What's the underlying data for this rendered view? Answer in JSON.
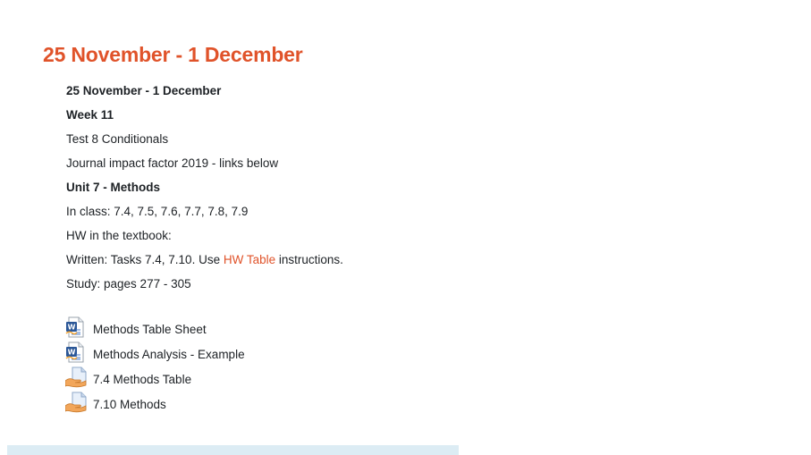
{
  "section": {
    "title": "25 November - 1 December",
    "summary": {
      "dates": "25 November - 1  December",
      "week": "Week 11",
      "test": "Test 8 Conditionals",
      "journal": "Journal impact factor 2019 - links below",
      "unit": "Unit 7 - Methods",
      "in_class": "In class: 7.4, 7.5, 7.6, 7.7, 7.8, 7.9",
      "hw_heading": "HW in the textbook:",
      "written_prefix": "Written:  Tasks 7.4, 7.10. Use ",
      "written_link": "HW Table",
      "written_suffix": " instructions.",
      "study": "Study: pages 277 - 305"
    },
    "activities": [
      {
        "icon": "word-document-icon",
        "label": "Methods Table Sheet"
      },
      {
        "icon": "word-document-icon",
        "label": "Methods Analysis - Example"
      },
      {
        "icon": "assignment-icon",
        "label": "7.4 Methods Table"
      },
      {
        "icon": "assignment-icon",
        "label": "7.10 Methods"
      }
    ]
  },
  "colors": {
    "accent": "#e0532a",
    "text": "#1d2125",
    "next_section_bar": "#dcecf4"
  }
}
